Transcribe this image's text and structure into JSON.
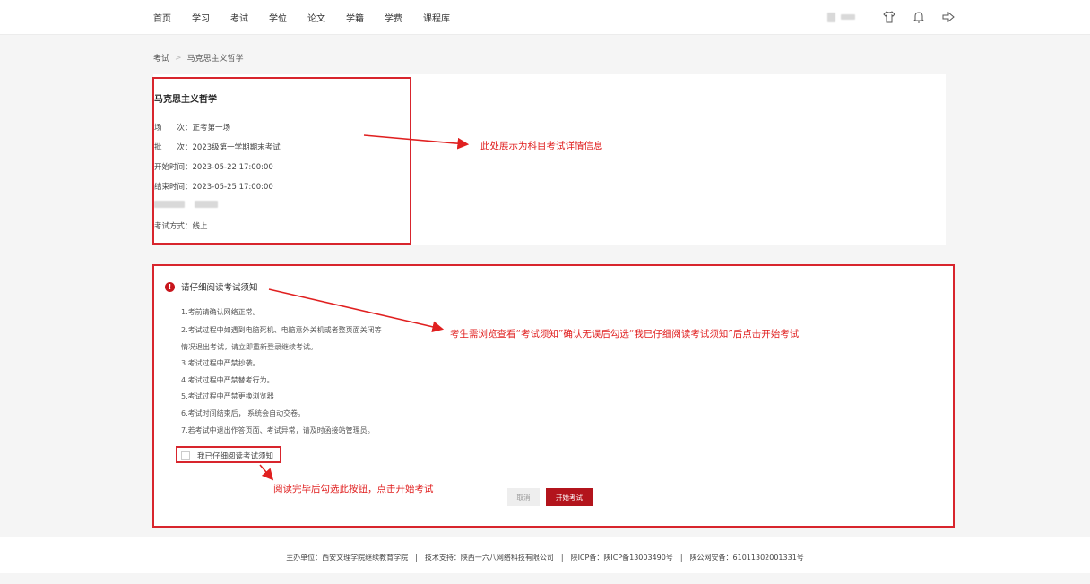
{
  "nav": {
    "items": [
      "首页",
      "学习",
      "考试",
      "学位",
      "论文",
      "学籍",
      "学费",
      "课程库"
    ]
  },
  "breadcrumb": {
    "parent": "考试",
    "separator": ">",
    "current": "马克思主义哲学"
  },
  "exam_info": {
    "title": "马克思主义哲学",
    "session_label": "场　　次：",
    "session_value": "正考第一场",
    "batch_label": "批　　次：",
    "batch_value": "2023级第一学期期末考试",
    "start_label": "开始时间：",
    "start_value": "2023-05-22 17:00:00",
    "end_label": "结束时间：",
    "end_value": "2023-05-25 17:00:00",
    "mode_label": "考试方式：",
    "mode_value": "线上"
  },
  "notice": {
    "heading": "请仔细阅读考试须知",
    "rules": [
      "1.考前请确认网络正常。",
      "2.考试过程中如遇到电脑死机、电脑意外关机或者整页面关闭等",
      "情况退出考试，请立即重新登录继续考试。",
      "3.考试过程中严禁抄袭。",
      "4.考试过程中严禁替考行为。",
      "5.考试过程中严禁更换浏览器",
      "6.考试时间结束后， 系统会自动交卷。",
      "7.若考试中退出作答页面、考试异常，请及时函接站管理员。"
    ],
    "checkbox_label": "我已仔细阅读考试须知",
    "cancel_label": "取消",
    "start_label": "开始考试"
  },
  "annotations": {
    "a1": "此处展示为科目考试详情信息",
    "a2": "考生需浏览查看“考试须知”确认无误后勾选“我已仔细阅读考试须知”后点击开始考试",
    "a3": "阅读完毕后勾选此按钮，点击开始考试"
  },
  "footer": {
    "text": "主办单位：西安文理学院继续教育学院　|　技术支持：陕西一六八网络科技有限公司　|　陕ICP备：陕ICP备13003490号　|　陕公网安备：61011302001331号"
  },
  "colors": {
    "accent": "#b3141c",
    "annotation": "#e02020"
  }
}
